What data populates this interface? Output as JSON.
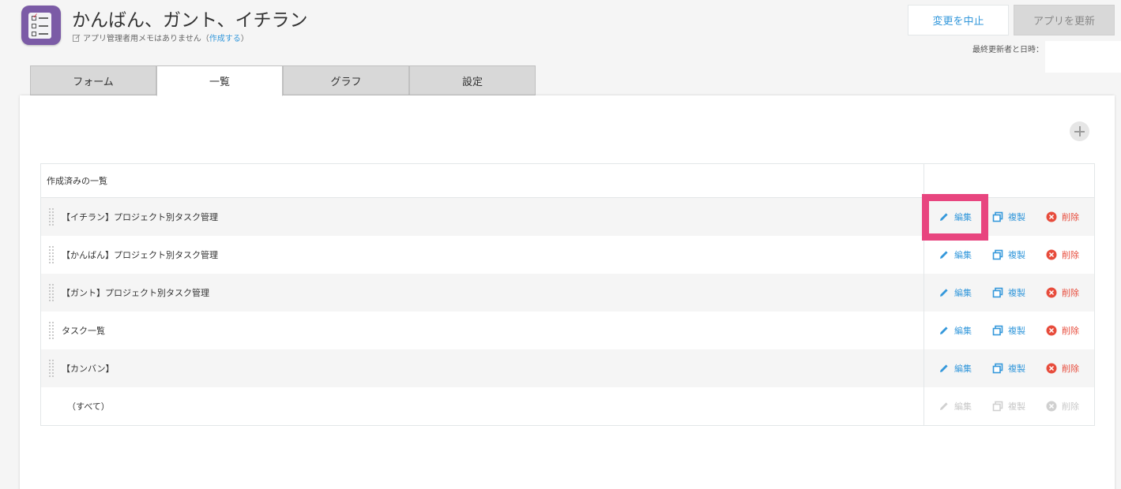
{
  "app": {
    "title": "かんばん、ガント、イチラン",
    "memo_prefix": "アプリ管理者用メモはありません（",
    "memo_link": "作成する",
    "memo_suffix": "）"
  },
  "header": {
    "cancel_label": "変更を中止",
    "update_label": "アプリを更新",
    "last_updated_label": "最終更新者と日時："
  },
  "tabs": [
    {
      "label": "フォーム",
      "active": false
    },
    {
      "label": "一覧",
      "active": true
    },
    {
      "label": "グラフ",
      "active": false
    },
    {
      "label": "設定",
      "active": false
    }
  ],
  "views": {
    "header": "作成済みの一覧",
    "actions": {
      "edit": "編集",
      "copy": "複製",
      "delete": "削除"
    },
    "rows": [
      {
        "name": "【イチラン】プロジェクト別タスク管理"
      },
      {
        "name": "【かんばん】プロジェクト別タスク管理"
      },
      {
        "name": "【ガント】プロジェクト別タスク管理"
      },
      {
        "name": "タスク一覧"
      },
      {
        "name": "【カンバン】"
      },
      {
        "name": "（すべて）"
      }
    ]
  },
  "colors": {
    "accent": "#3498db",
    "danger": "#e74c3c",
    "highlight": "#e8457f",
    "app_icon": "#7b5ba6"
  }
}
